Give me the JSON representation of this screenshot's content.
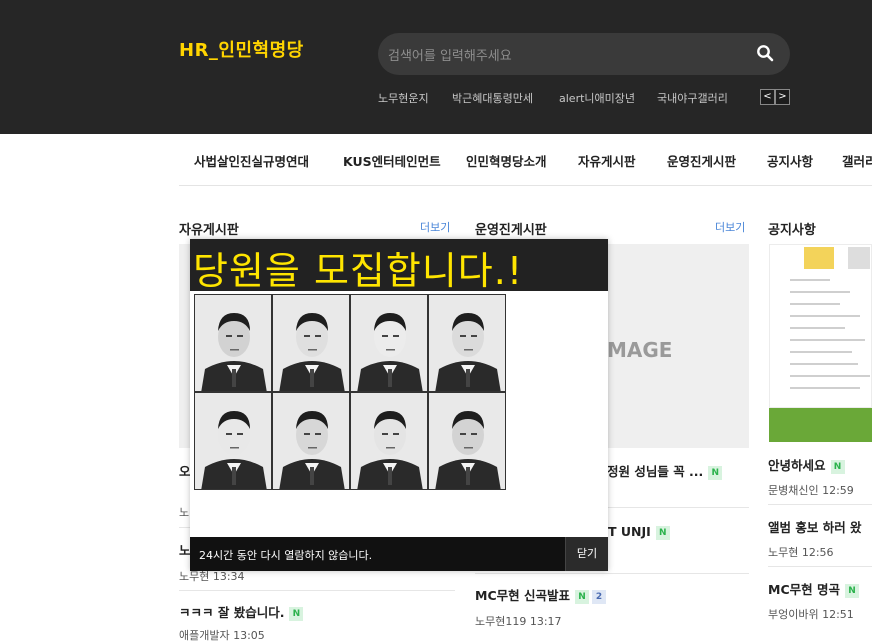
{
  "header": {
    "logo": "HR_인민혁명당",
    "search_placeholder": "검색어를 입력해주세요",
    "rank_items": [
      "노무현운지",
      "박근혜대통령만세",
      "alert니애미장년",
      "국내야구갤러리"
    ],
    "prev_label": "<",
    "next_label": ">"
  },
  "nav": [
    "사법살인진실규명연대",
    "KUS엔터테인먼트",
    "인민혁명당소개",
    "자유게시판",
    "운영진게시판",
    "공지사항",
    "갤러리"
  ],
  "sections": {
    "free_board": {
      "title": "자유게시판",
      "more": "더보기",
      "posts": [
        {
          "title": "오",
          "meta": "노"
        },
        {
          "title": "노",
          "meta": "노무현 13:34"
        },
        {
          "title": "ㅋㅋㅋ 잘 봤습니다.",
          "badge": "N",
          "meta": "애플개발자 13:05"
        }
      ]
    },
    "staff_board": {
      "title": "운영진게시판",
      "more": "더보기",
      "thumb_text": "MAGE",
      "posts": [
        {
          "title": "정원 성님들 꼭 ...",
          "badge": "N"
        },
        {
          "title": "T UNJI",
          "badge": "N"
        },
        {
          "title": "MC무현 신곡발표",
          "badge": "N",
          "comments": "2",
          "meta": "노무현119 13:17"
        }
      ]
    },
    "notice_board": {
      "title": "공지사항",
      "posts": [
        {
          "title": "안녕하세요",
          "badge": "N",
          "meta": "문병채신인 12:59"
        },
        {
          "title": "앨범 홍보 하러 왔",
          "meta": "노무현 12:56"
        },
        {
          "title": "MC무현 명곡",
          "badge": "N",
          "meta": "부엉이바위 12:51"
        }
      ]
    }
  },
  "popup": {
    "banner": "당원을 모집합니다.!",
    "dont_show": "24시간 동안 다시 열람하지 않습니다.",
    "close": "닫기",
    "photo_captions": [
      "",
      "",
      "",
      "",
      "",
      "",
      "",
      ""
    ]
  },
  "colors": {
    "header_bg": "#262626",
    "logo": "#ffd400",
    "banner_text": "#ffe500",
    "link_blue": "#4a86d8",
    "new_badge": "#2bb24c"
  }
}
